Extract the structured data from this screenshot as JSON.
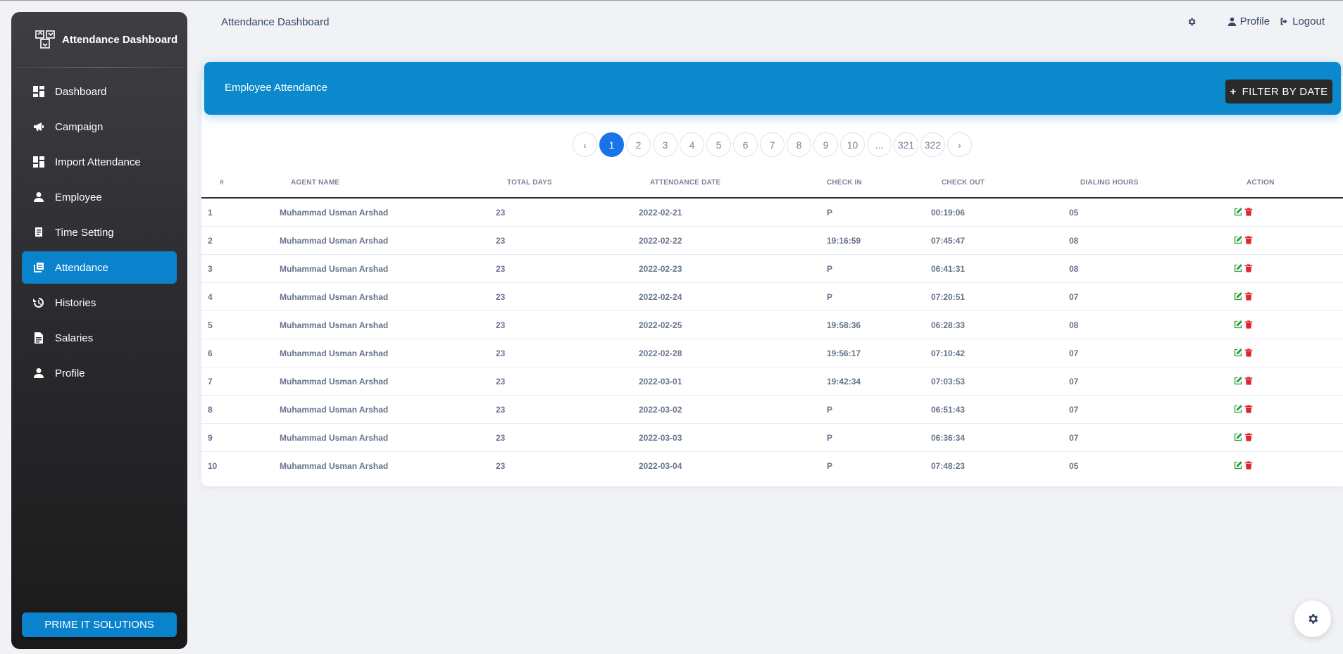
{
  "sidebar": {
    "brand": "Attendance Dashboard",
    "items": [
      {
        "label": "Dashboard",
        "icon": "dashboard-icon"
      },
      {
        "label": "Campaign",
        "icon": "megaphone-icon"
      },
      {
        "label": "Import Attendance",
        "icon": "dashboard-icon"
      },
      {
        "label": "Employee",
        "icon": "person-icon"
      },
      {
        "label": "Time Setting",
        "icon": "receipt-icon"
      },
      {
        "label": "Attendance",
        "icon": "copy-icon",
        "active": true
      },
      {
        "label": "Histories",
        "icon": "history-icon"
      },
      {
        "label": "Salaries",
        "icon": "document-icon"
      },
      {
        "label": "Profile",
        "icon": "person-icon"
      }
    ],
    "footer_label": "PRIME IT SOLUTIONS"
  },
  "header": {
    "breadcrumb": "Attendance Dashboard",
    "profile_label": "Profile",
    "logout_label": "Logout"
  },
  "card": {
    "title": "Employee Attendance",
    "filter_label": "FILTER BY DATE"
  },
  "pagination": {
    "prev": "‹",
    "next": "›",
    "pages": [
      "1",
      "2",
      "3",
      "4",
      "5",
      "6",
      "7",
      "8",
      "9",
      "10",
      "...",
      "321",
      "322"
    ],
    "current": "1"
  },
  "table": {
    "columns": [
      "#",
      "AGENT NAME",
      "TOTAL DAYS",
      "ATTENDANCE DATE",
      "CHECK IN",
      "CHECK OUT",
      "DIALING HOURS",
      "ACTION"
    ],
    "rows": [
      [
        "1",
        "Muhammad Usman Arshad",
        "23",
        "2022-02-21",
        "P",
        "00:19:06",
        "05"
      ],
      [
        "2",
        "Muhammad Usman Arshad",
        "23",
        "2022-02-22",
        "19:16:59",
        "07:45:47",
        "08"
      ],
      [
        "3",
        "Muhammad Usman Arshad",
        "23",
        "2022-02-23",
        "P",
        "06:41:31",
        "08"
      ],
      [
        "4",
        "Muhammad Usman Arshad",
        "23",
        "2022-02-24",
        "P",
        "07:20:51",
        "07"
      ],
      [
        "5",
        "Muhammad Usman Arshad",
        "23",
        "2022-02-25",
        "19:58:36",
        "06:28:33",
        "08"
      ],
      [
        "6",
        "Muhammad Usman Arshad",
        "23",
        "2022-02-28",
        "19:56:17",
        "07:10:42",
        "07"
      ],
      [
        "7",
        "Muhammad Usman Arshad",
        "23",
        "2022-03-01",
        "19:42:34",
        "07:03:53",
        "07"
      ],
      [
        "8",
        "Muhammad Usman Arshad",
        "23",
        "2022-03-02",
        "P",
        "06:51:43",
        "07"
      ],
      [
        "9",
        "Muhammad Usman Arshad",
        "23",
        "2022-03-03",
        "P",
        "06:36:34",
        "07"
      ],
      [
        "10",
        "Muhammad Usman Arshad",
        "23",
        "2022-03-04",
        "P",
        "07:48:23",
        "05"
      ]
    ]
  },
  "colors": {
    "accent": "#0b89cc",
    "sidebar_active": "#0b83cc",
    "page_active": "#1a73e8",
    "edit": "#2e9d3a",
    "delete": "#e0252f"
  }
}
